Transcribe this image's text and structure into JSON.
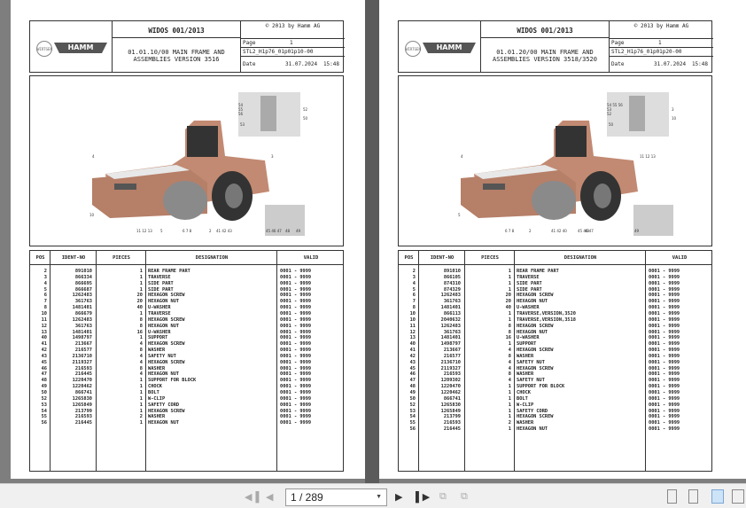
{
  "pages": [
    {
      "widos": "WIDOS 001/2013",
      "copyright": "© 2013 by Hamm AG",
      "title_line1": "01.01.10/00 MAIN FRAME AND",
      "title_line2": "ASSEMBLIES  VERSION 3516",
      "page_label": "Page",
      "page_value": "1",
      "doc_code": "STL2_H1p76_01p01p10-00",
      "date_label": "Date",
      "date": "31.07.2024",
      "time": "15:48",
      "logo_wirtgen": "WIRTGEN GROUP",
      "logo_hamm": "HAMM",
      "callouts": [
        "4",
        "54",
        "55",
        "56",
        "53",
        "52",
        "50",
        "3",
        "10",
        "11 12 13",
        "5",
        "6 7 8",
        "2",
        "41 42 43",
        "45 46 47",
        "48",
        "49"
      ],
      "headers": [
        "POS",
        "IDENT-NO",
        "PIECES",
        "DESIGNATION",
        "VALID"
      ],
      "rows": [
        [
          "2",
          "891010",
          "1",
          "REAR FRAME PART",
          "0001 - 9999"
        ],
        [
          "3",
          "866334",
          "1",
          "TRAVERSE",
          "0001 - 9999"
        ],
        [
          "4",
          "866695",
          "1",
          "SIDE PART",
          "0001 - 9999"
        ],
        [
          "5",
          "866687",
          "1",
          "SIDE PART",
          "0001 - 9999"
        ],
        [
          "6",
          "1262483",
          "20",
          "HEXAGON SCREW",
          "0001 - 9999"
        ],
        [
          "7",
          "361763",
          "20",
          "HEXAGON NUT",
          "0001 - 9999"
        ],
        [
          "8",
          "1481401",
          "40",
          "U-WASHER",
          "0001 - 9999"
        ],
        [
          "10",
          "866679",
          "1",
          "TRAVERSE",
          "0001 - 9999"
        ],
        [
          "11",
          "1262483",
          "8",
          "HEXAGON SCREW",
          "0001 - 9999"
        ],
        [
          "12",
          "361763",
          "8",
          "HEXAGON NUT",
          "0001 - 9999"
        ],
        [
          "13",
          "1481401",
          "16",
          "U-WASHER",
          "0001 - 9999"
        ],
        [
          "40",
          "1498797",
          "1",
          "SUPPORT",
          "0001 - 9999"
        ],
        [
          "41",
          "213667",
          "4",
          "HEXAGON SCREW",
          "0001 - 9999"
        ],
        [
          "42",
          "216577",
          "8",
          "WASHER",
          "0001 - 9999"
        ],
        [
          "43",
          "2136710",
          "4",
          "SAFETY NUT",
          "0001 - 9999"
        ],
        [
          "45",
          "2119327",
          "4",
          "HEXAGON SCREW",
          "0001 - 9999"
        ],
        [
          "46",
          "216593",
          "8",
          "WASHER",
          "0001 - 9999"
        ],
        [
          "47",
          "216445",
          "4",
          "HEXAGON NUT",
          "0001 - 9999"
        ],
        [
          "48",
          "1220470",
          "1",
          "SUPPORT FOR BLOCK",
          "0001 - 9999"
        ],
        [
          "49",
          "1220462",
          "1",
          "CHOCK",
          "0001 - 9999"
        ],
        [
          "50",
          "866741",
          "1",
          "BOLT",
          "0001 - 9999"
        ],
        [
          "52",
          "1265830",
          "1",
          "W-CLIP",
          "0001 - 9999"
        ],
        [
          "53",
          "1265849",
          "1",
          "SAFETY CORD",
          "0001 - 9999"
        ],
        [
          "54",
          "213799",
          "1",
          "HEXAGON SCREW",
          "0001 - 9999"
        ],
        [
          "55",
          "216593",
          "2",
          "WASHER",
          "0001 - 9999"
        ],
        [
          "56",
          "216445",
          "1",
          "HEXAGON NUT",
          "0001 - 9999"
        ]
      ]
    },
    {
      "widos": "WIDOS 001/2013",
      "copyright": "© 2013 by Hamm AG",
      "title_line1": "01.01.20/00 MAIN FRAME AND",
      "title_line2": "ASSEMBLIES  VERSION 3518/3520",
      "page_label": "Page",
      "page_value": "1",
      "doc_code": "STL2_H1p76_01p01p20-00",
      "date_label": "Date",
      "date": "31.07.2024",
      "time": "15:48",
      "logo_wirtgen": "WIRTGEN GROUP",
      "logo_hamm": "HAMM",
      "callouts": [
        "4",
        "54 55 56",
        "53",
        "52",
        "50",
        "3",
        "10",
        "11 12 13",
        "5",
        "6 7 8",
        "2",
        "41 42 40",
        "45 46 47",
        "48",
        "49"
      ],
      "headers": [
        "POS",
        "IDENT-NO",
        "PIECES",
        "DESIGNATION",
        "VALID"
      ],
      "rows": [
        [
          "2",
          "891010",
          "1",
          "REAR FRAME PART",
          "0001 - 9999"
        ],
        [
          "3",
          "866105",
          "1",
          "TRAVERSE",
          "0001 - 9999"
        ],
        [
          "4",
          "874310",
          "1",
          "SIDE PART",
          "0001 - 9999"
        ],
        [
          "5",
          "874329",
          "1",
          "SIDE PART",
          "0001 - 9999"
        ],
        [
          "6",
          "1262483",
          "20",
          "HEXAGON SCREW",
          "0001 - 9999"
        ],
        [
          "7",
          "361763",
          "20",
          "HEXAGON NUT",
          "0001 - 9999"
        ],
        [
          "8",
          "1481401",
          "40",
          "U-WASHER",
          "0001 - 9999"
        ],
        [
          "10",
          "866113",
          "1",
          "TRAVERSE,VERSION,3520",
          "0001 - 9999"
        ],
        [
          "10",
          "2040632",
          "1",
          "TRAVERSE,VERSION,3518",
          "0001 - 9999"
        ],
        [
          "11",
          "1262483",
          "8",
          "HEXAGON SCREW",
          "0001 - 9999"
        ],
        [
          "12",
          "361763",
          "8",
          "HEXAGON NUT",
          "0001 - 9999"
        ],
        [
          "13",
          "1481401",
          "16",
          "U-WASHER",
          "0001 - 9999"
        ],
        [
          "40",
          "1498797",
          "1",
          "SUPPORT",
          "0001 - 9999"
        ],
        [
          "41",
          "213667",
          "4",
          "HEXAGON SCREW",
          "0001 - 9999"
        ],
        [
          "42",
          "216577",
          "8",
          "WASHER",
          "0001 - 9999"
        ],
        [
          "43",
          "2136710",
          "4",
          "SAFETY NUT",
          "0001 - 9999"
        ],
        [
          "45",
          "2119327",
          "4",
          "HEXAGON SCREW",
          "0001 - 9999"
        ],
        [
          "46",
          "216593",
          "8",
          "WASHER",
          "0001 - 9999"
        ],
        [
          "47",
          "1209302",
          "4",
          "SAFETY NUT",
          "0001 - 9999"
        ],
        [
          "48",
          "1220470",
          "1",
          "SUPPORT FOR BLOCK",
          "0001 - 9999"
        ],
        [
          "49",
          "1220462",
          "1",
          "CHOCK",
          "0001 - 9999"
        ],
        [
          "50",
          "866741",
          "1",
          "BOLT",
          "0001 - 9999"
        ],
        [
          "52",
          "1265830",
          "1",
          "W-CLIP",
          "0001 - 9999"
        ],
        [
          "53",
          "1265849",
          "1",
          "SAFETY CORD",
          "0001 - 9999"
        ],
        [
          "54",
          "213799",
          "1",
          "HEXAGON SCREW",
          "0001 - 9999"
        ],
        [
          "55",
          "216593",
          "2",
          "WASHER",
          "0001 - 9999"
        ],
        [
          "56",
          "216445",
          "1",
          "HEXAGON NUT",
          "0001 - 9999"
        ]
      ]
    }
  ],
  "toolbar": {
    "page_field": "1 / 289",
    "icons": [
      "first-page-icon",
      "previous-page-icon",
      "next-page-icon",
      "last-page-icon",
      "previous-view-icon",
      "next-view-icon",
      "single-page-icon",
      "continuous-icon",
      "facing-icon",
      "continuous-facing-icon"
    ]
  },
  "colors": {
    "viewer_bg": "#7e7e7e",
    "toolbar_bg": "#f0f0f0",
    "active_view": "#cde3f7"
  }
}
